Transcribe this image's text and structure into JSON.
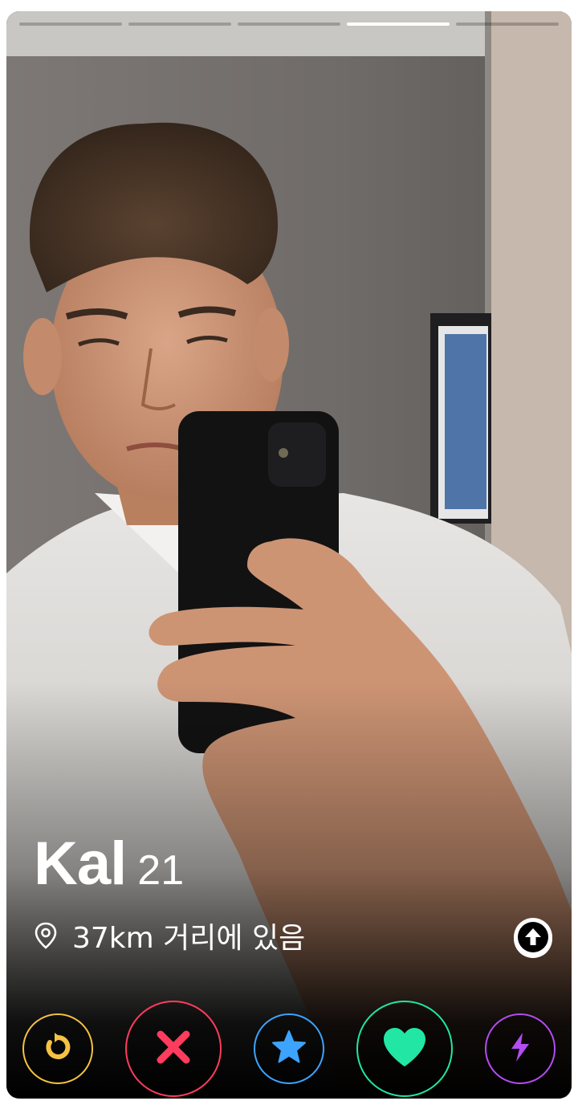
{
  "profile": {
    "name": "Kal",
    "age": "21",
    "distance": "37km 거리에 있음"
  },
  "photo_indicator": {
    "total": 5,
    "active_index": 3
  },
  "icons": {
    "location": "location-pin-icon",
    "expand": "arrow-up-icon",
    "rewind": "rewind-icon",
    "nope": "close-x-icon",
    "super_like": "star-icon",
    "like": "heart-icon",
    "boost": "lightning-bolt-icon"
  },
  "colors": {
    "rewind": "#f5c242",
    "nope": "#fe3c5d",
    "super_like": "#3ca4ff",
    "like": "#21e6a4",
    "boost": "#b44cf2"
  }
}
